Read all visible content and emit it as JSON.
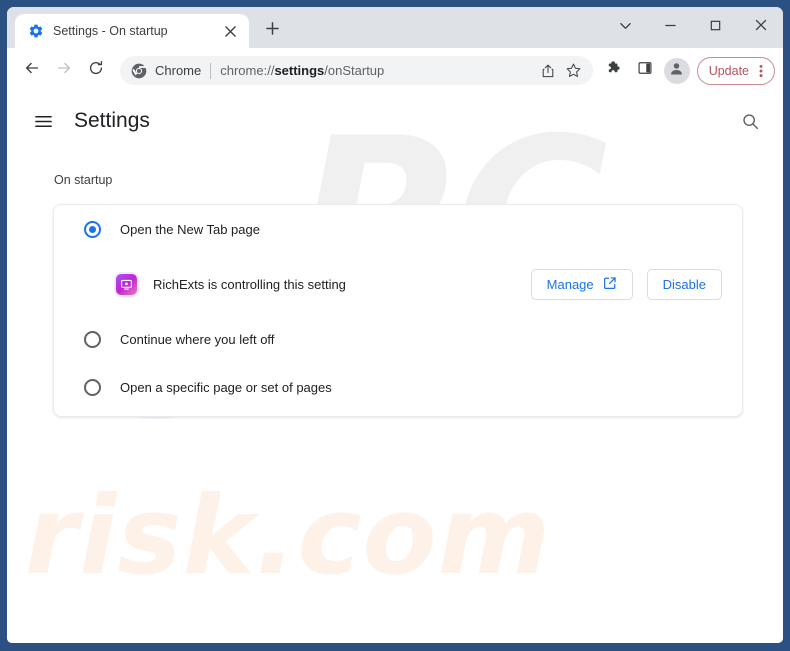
{
  "window": {
    "frame_color": "#2b5183",
    "controls": {
      "chevron_down": "chevron-down-icon",
      "minimize": "minimize-icon",
      "maximize": "maximize-icon",
      "close": "close-icon"
    }
  },
  "tabstrip": {
    "tabs": [
      {
        "title": "Settings - On startup",
        "favicon": "settings-gear-icon",
        "close": "close-icon",
        "active": true
      }
    ],
    "new_tab_label": "+",
    "new_tab_icon": "plus-icon"
  },
  "toolbar": {
    "back_icon": "back-arrow-icon",
    "forward_icon": "forward-arrow-icon",
    "reload_icon": "reload-icon",
    "omnibox": {
      "chrome_icon": "chrome-logo-icon",
      "chrome_label": "Chrome",
      "url_prefix": "chrome://",
      "url_bold": "settings",
      "url_suffix": "/onStartup",
      "full_url": "chrome://settings/onStartup",
      "share_icon": "share-icon",
      "bookmark_icon": "star-icon"
    },
    "extensions_icon": "puzzle-piece-icon",
    "side_panel_icon": "side-panel-icon",
    "profile_icon": "account-avatar-icon",
    "update_label": "Update",
    "update_border_color": "#c98b90",
    "update_text_color": "#b4555d",
    "menu_icon": "three-dots-vertical-icon"
  },
  "settings_page": {
    "menu_icon": "hamburger-menu-icon",
    "title": "Settings",
    "search_icon": "search-icon",
    "section_label": "On startup",
    "accent_color": "#1a73e8",
    "options": [
      {
        "label": "Open the New Tab page",
        "selected": true
      },
      {
        "label": "Continue where you left off",
        "selected": false
      },
      {
        "label": "Open a specific page or set of pages",
        "selected": false
      }
    ],
    "extension_notice": {
      "icon": "richexts-extension-icon",
      "text": "RichExts is controlling this setting",
      "manage_label": "Manage",
      "manage_icon": "open-in-new-icon",
      "disable_label": "Disable"
    }
  },
  "watermarks": {
    "top": "PC",
    "bottom": "risk.com"
  }
}
